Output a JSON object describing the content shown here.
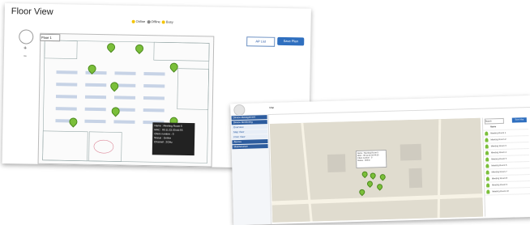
{
  "floor_view": {
    "title": "Floor View",
    "legend": [
      "Online",
      "Offline",
      "Busy"
    ],
    "legend_colors": [
      "#f4c400",
      "#888888",
      "#f4c400"
    ],
    "floor_select": "Floor 1",
    "ap_list_label": "AP List",
    "save_label": "Save Plan",
    "tooltip": [
      "Name : Meeting Room 5",
      "MAC : 00:11:22:33:44:55",
      "Client number : 0",
      "Status : Online",
      "Channel : 2GHz"
    ]
  },
  "map_view": {
    "header_tab": "Map",
    "nav": [
      "Device Management",
      "Device Monitoring",
      "Overview",
      "Map View",
      "Floor View",
      "Alarms",
      "Maintenance"
    ],
    "list_header": "Name",
    "list_items": [
      "Meeting Room 1",
      "Meeting Room 2",
      "Meeting Room 3",
      "Meeting Room 4",
      "Meeting Room 5",
      "Meeting Room 6",
      "Meeting Room 7",
      "Meeting Room 8",
      "Meeting Room 9",
      "Meeting Room 10"
    ],
    "search_placeholder": "Search",
    "save_label": "Save Map",
    "info": [
      "Name : Meeting Room 5",
      "MAC : 00:11:22:33:44:55",
      "Client number : 0",
      "Status : Online"
    ]
  },
  "icons": {
    "zoom": "pan-icon",
    "pin": "access-point-pin-icon"
  }
}
